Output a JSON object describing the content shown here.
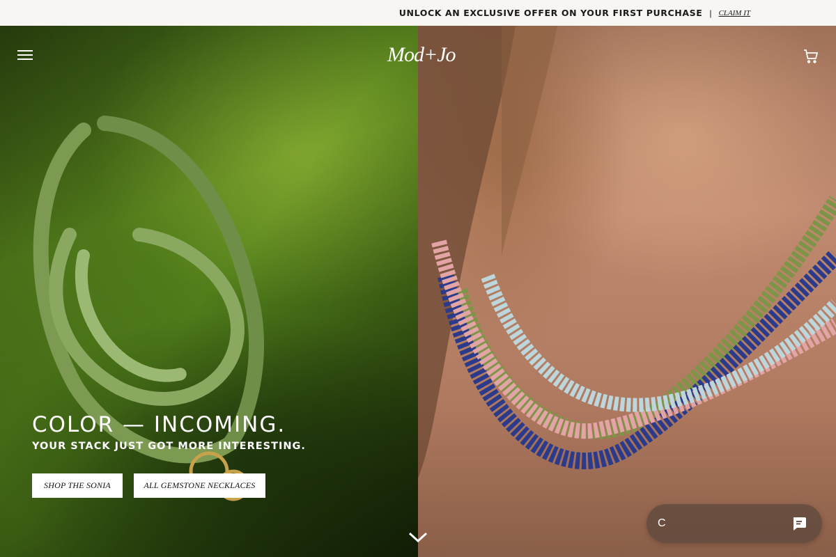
{
  "announcement": {
    "text": "UNLOCK AN EXCLUSIVE OFFER ON YOUR FIRST PURCHASE",
    "separator": "|",
    "link_label": "CLAIM IT"
  },
  "header": {
    "logo_text": "Mod+Jo",
    "menu_icon": "hamburger-menu-icon",
    "cart_icon": "shopping-bag-icon"
  },
  "hero": {
    "headline": "COLOR — INCOMING.",
    "subline": "YOUR STACK JUST GOT MORE INTERESTING.",
    "buttons": [
      {
        "label": "SHOP THE SONIA"
      },
      {
        "label": "ALL GEMSTONE NECKLACES"
      }
    ],
    "scroll_icon": "chevron-down-icon"
  },
  "chat": {
    "text": "C",
    "icon": "chat-bubble-icon"
  },
  "colors": {
    "announcement_bg": "#f7f6f2",
    "left_panel": "#4a7418",
    "right_panel": "#b07a60",
    "button_bg": "#ffffff"
  }
}
